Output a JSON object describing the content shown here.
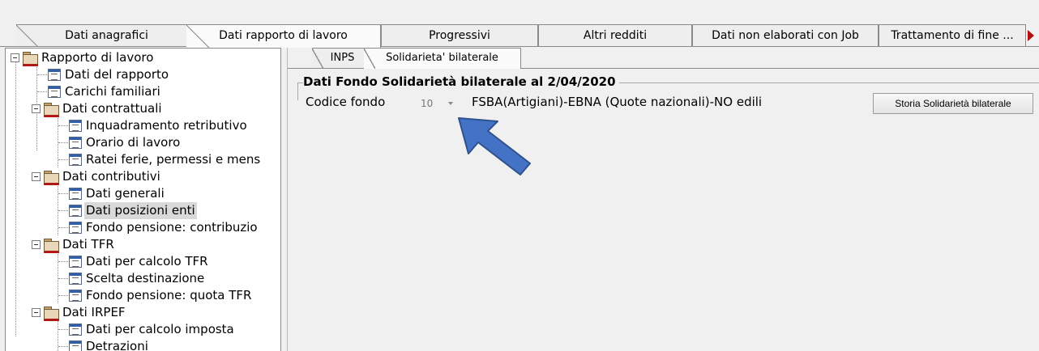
{
  "main_tabs": [
    {
      "label": "Dati anagrafici",
      "active": false
    },
    {
      "label": "Dati rapporto di lavoro",
      "active": true
    },
    {
      "label": "Progressivi",
      "active": false
    },
    {
      "label": "Altri redditi",
      "active": false
    },
    {
      "label": "Dati non elaborati con Job",
      "active": false
    },
    {
      "label": "Trattamento di fine ...",
      "active": false
    }
  ],
  "tree": [
    {
      "label": "Rapporto di lavoro",
      "type": "folder"
    },
    {
      "label": "Dati del rapporto",
      "type": "doc"
    },
    {
      "label": "Carichi familiari",
      "type": "doc"
    },
    {
      "label": "Dati contrattuali",
      "type": "folder"
    },
    {
      "label": "Inquadramento retributivo",
      "type": "doc"
    },
    {
      "label": "Orario di lavoro",
      "type": "doc"
    },
    {
      "label": "Ratei ferie, permessi e mens",
      "type": "doc"
    },
    {
      "label": "Dati contributivi",
      "type": "folder"
    },
    {
      "label": "Dati generali",
      "type": "doc"
    },
    {
      "label": "Dati posizioni enti",
      "type": "doc",
      "selected": true
    },
    {
      "label": "Fondo pensione: contribuzio",
      "type": "doc"
    },
    {
      "label": "Dati TFR",
      "type": "folder"
    },
    {
      "label": "Dati per calcolo TFR",
      "type": "doc"
    },
    {
      "label": "Scelta destinazione",
      "type": "doc"
    },
    {
      "label": "Fondo pensione: quota TFR",
      "type": "doc"
    },
    {
      "label": "Dati IRPEF",
      "type": "folder"
    },
    {
      "label": "Dati per calcolo imposta",
      "type": "doc"
    },
    {
      "label": "Detrazioni",
      "type": "doc"
    }
  ],
  "sub_tabs": [
    {
      "label": "INPS",
      "active": false
    },
    {
      "label": "Solidarieta' bilaterale",
      "active": true
    }
  ],
  "group": {
    "title": "Dati Fondo Solidarietà bilaterale al  2/04/2020"
  },
  "codice": {
    "label": "Codice fondo",
    "value": "10",
    "description": "FSBA(Artigiani)-EBNA (Quote nazionali)-NO edili"
  },
  "storia_button": "Storia Solidarietà bilaterale",
  "colors": {
    "arrow_fill": "#4472c4",
    "arrow_stroke": "#2f528f",
    "selection": "#d9d9d9",
    "tab_scroll_arrow": "#b01010"
  },
  "icons": {
    "folder": "folder-icon",
    "doc": "document-icon",
    "expand": "collapse-minus-icon",
    "scroll": "tab-scroll-right-icon",
    "pointer": "blue-arrow-annotation"
  }
}
